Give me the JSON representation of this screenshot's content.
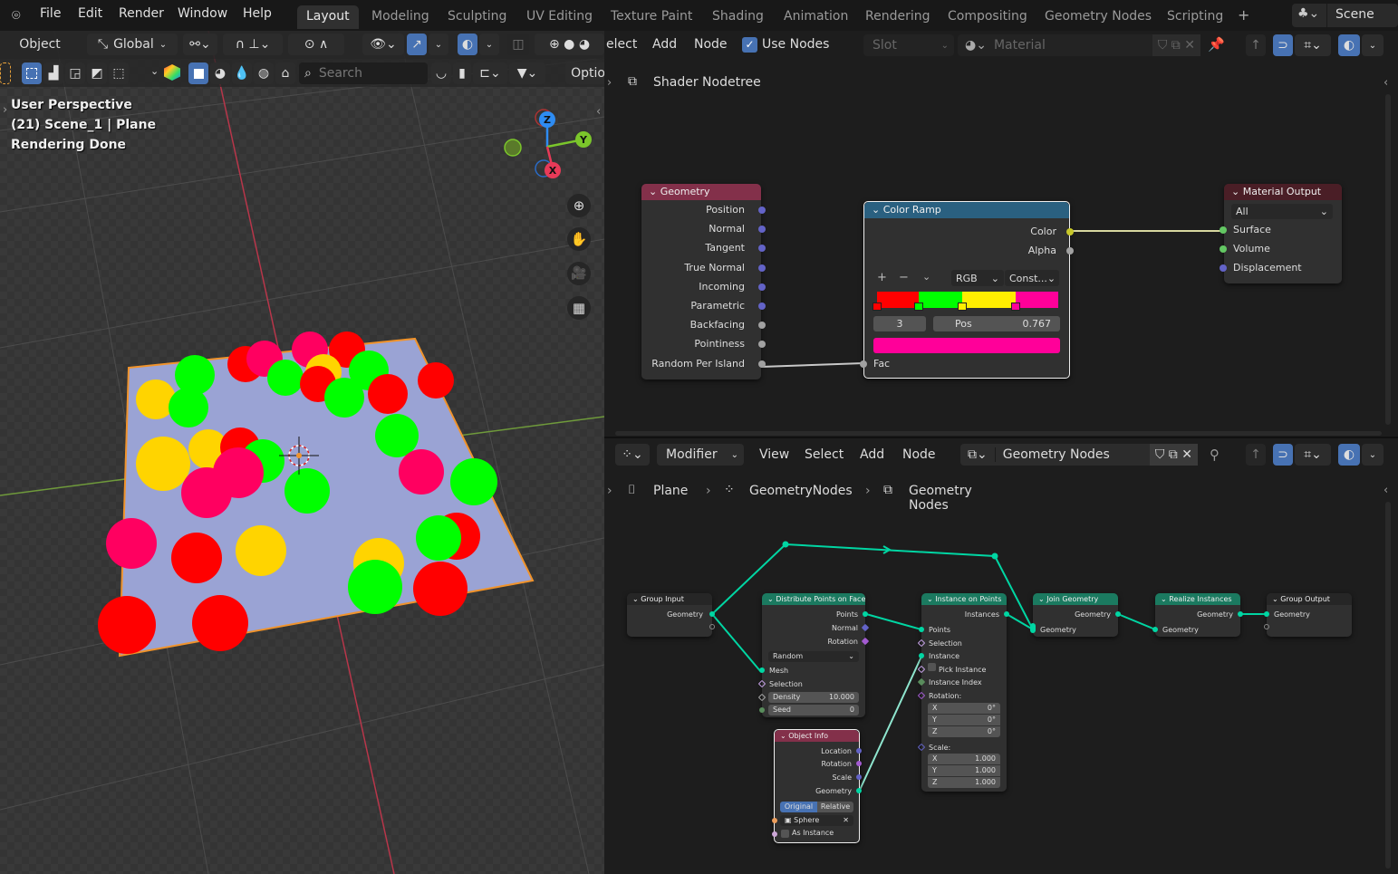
{
  "topbar": {
    "menus": [
      "File",
      "Edit",
      "Render",
      "Window",
      "Help"
    ],
    "workspaces": [
      "Layout",
      "Modeling",
      "Sculpting",
      "UV Editing",
      "Texture Paint",
      "Shading",
      "Animation",
      "Rendering",
      "Compositing",
      "Geometry Nodes",
      "Scripting"
    ],
    "active_workspace": "Layout",
    "add_workspace": "+",
    "scene": "Scene"
  },
  "viewport": {
    "mode": "Object",
    "orientation": "Global",
    "search_placeholder": "Search",
    "options": "Optio",
    "overlay_lines": [
      "User Perspective",
      "(21) Scene_1 | Plane",
      "Rendering Done"
    ],
    "gizmo": {
      "z": "Z",
      "y": "Y",
      "x": "X"
    },
    "colors": {
      "plane": "#9aa3d4",
      "outline": "#f0932b"
    }
  },
  "shader_editor": {
    "header": {
      "select": "elect",
      "add": "Add",
      "node": "Node",
      "use_nodes": "Use Nodes",
      "slot": "Slot",
      "material_placeholder": "Material"
    },
    "breadcrumb": "Shader Nodetree",
    "geometry_node": {
      "title": "Geometry",
      "outputs": [
        "Position",
        "Normal",
        "Tangent",
        "True Normal",
        "Incoming",
        "Parametric",
        "Backfacing",
        "Pointiness",
        "Random Per Island"
      ]
    },
    "color_ramp": {
      "title": "Color Ramp",
      "outputs": [
        "Color",
        "Alpha"
      ],
      "mode": "RGB",
      "interp": "Const...",
      "index": "3",
      "pos_label": "Pos",
      "pos_value": "0.767",
      "input": "Fac",
      "stops": [
        {
          "pos": 0.0,
          "color": "#ff0000"
        },
        {
          "pos": 0.23,
          "color": "#00ff00"
        },
        {
          "pos": 0.47,
          "color": "#ffee00"
        },
        {
          "pos": 0.767,
          "color": "#ff0099"
        }
      ],
      "active_color": "#ff0099"
    },
    "material_output": {
      "title": "Material Output",
      "target": "All",
      "inputs": [
        "Surface",
        "Volume",
        "Displacement"
      ]
    }
  },
  "geo_editor": {
    "header": {
      "modifier": "Modifier",
      "view": "View",
      "select": "Select",
      "add": "Add",
      "node": "Node",
      "tree": "Geometry Nodes"
    },
    "breadcrumb": [
      "Plane",
      "GeometryNodes",
      "Geometry Nodes"
    ],
    "group_input": {
      "title": "Group Input",
      "out": "Geometry"
    },
    "distribute": {
      "title": "Distribute Points on Faces",
      "outputs": [
        "Points",
        "Normal",
        "Rotation"
      ],
      "mode": "Random",
      "inputs": [
        "Mesh",
        "Selection"
      ],
      "density_label": "Density",
      "density": "10.000",
      "seed_label": "Seed",
      "seed": "0"
    },
    "object_info": {
      "title": "Object Info",
      "outputs": [
        "Location",
        "Rotation",
        "Scale",
        "Geometry"
      ],
      "original": "Original",
      "relative": "Relative",
      "object": "Sphere",
      "as_instance": "As Instance"
    },
    "instance": {
      "title": "Instance on Points",
      "output": "Instances",
      "inputs": [
        "Points",
        "Selection",
        "Instance",
        "Pick Instance",
        "Instance Index",
        "Rotation:"
      ],
      "rotation": [
        [
          "X",
          "0°"
        ],
        [
          "Y",
          "0°"
        ],
        [
          "Z",
          "0°"
        ]
      ],
      "scale_label": "Scale:",
      "scale": [
        [
          "X",
          "1.000"
        ],
        [
          "Y",
          "1.000"
        ],
        [
          "Z",
          "1.000"
        ]
      ]
    },
    "join": {
      "title": "Join Geometry",
      "output": "Geometry",
      "input": "Geometry"
    },
    "realize": {
      "title": "Realize Instances",
      "output": "Geometry",
      "input": "Geometry"
    },
    "group_output": {
      "title": "Group Output",
      "input": "Geometry"
    }
  }
}
